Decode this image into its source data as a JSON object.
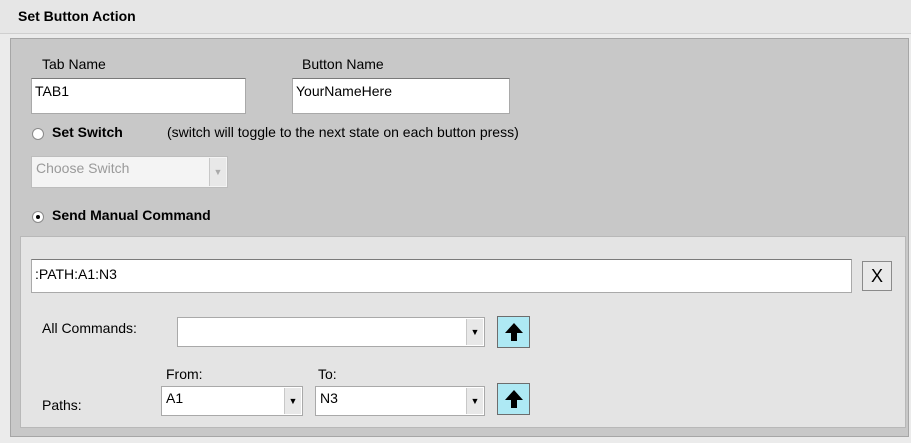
{
  "header": {
    "title": "Set Button Action"
  },
  "tab_name": {
    "label": "Tab Name",
    "value": "TAB1"
  },
  "button_name": {
    "label": "Button Name",
    "value": "YourNameHere"
  },
  "set_switch": {
    "label": "Set Switch",
    "hint": "(switch will toggle to the next state on each button press)",
    "selected": false,
    "combo_value": "Choose Switch",
    "combo_disabled": true
  },
  "manual_command": {
    "label": "Send Manual Command",
    "selected": true,
    "command_value": ":PATH:A1:N3",
    "clear_label": "X",
    "all_commands_label": "All Commands:",
    "all_commands_value": "",
    "paths_label": "Paths:",
    "from_label": "From:",
    "from_value": "A1",
    "to_label": "To:",
    "to_value": "N3"
  },
  "icons": {
    "dropdown": "chevron-down-icon",
    "insert": "arrow-up-icon",
    "clear": "close-icon"
  },
  "colors": {
    "insert_button_bg": "#aee9f4",
    "panel_bg": "#c8c8c8",
    "inner_bg": "#e4e4e4"
  }
}
